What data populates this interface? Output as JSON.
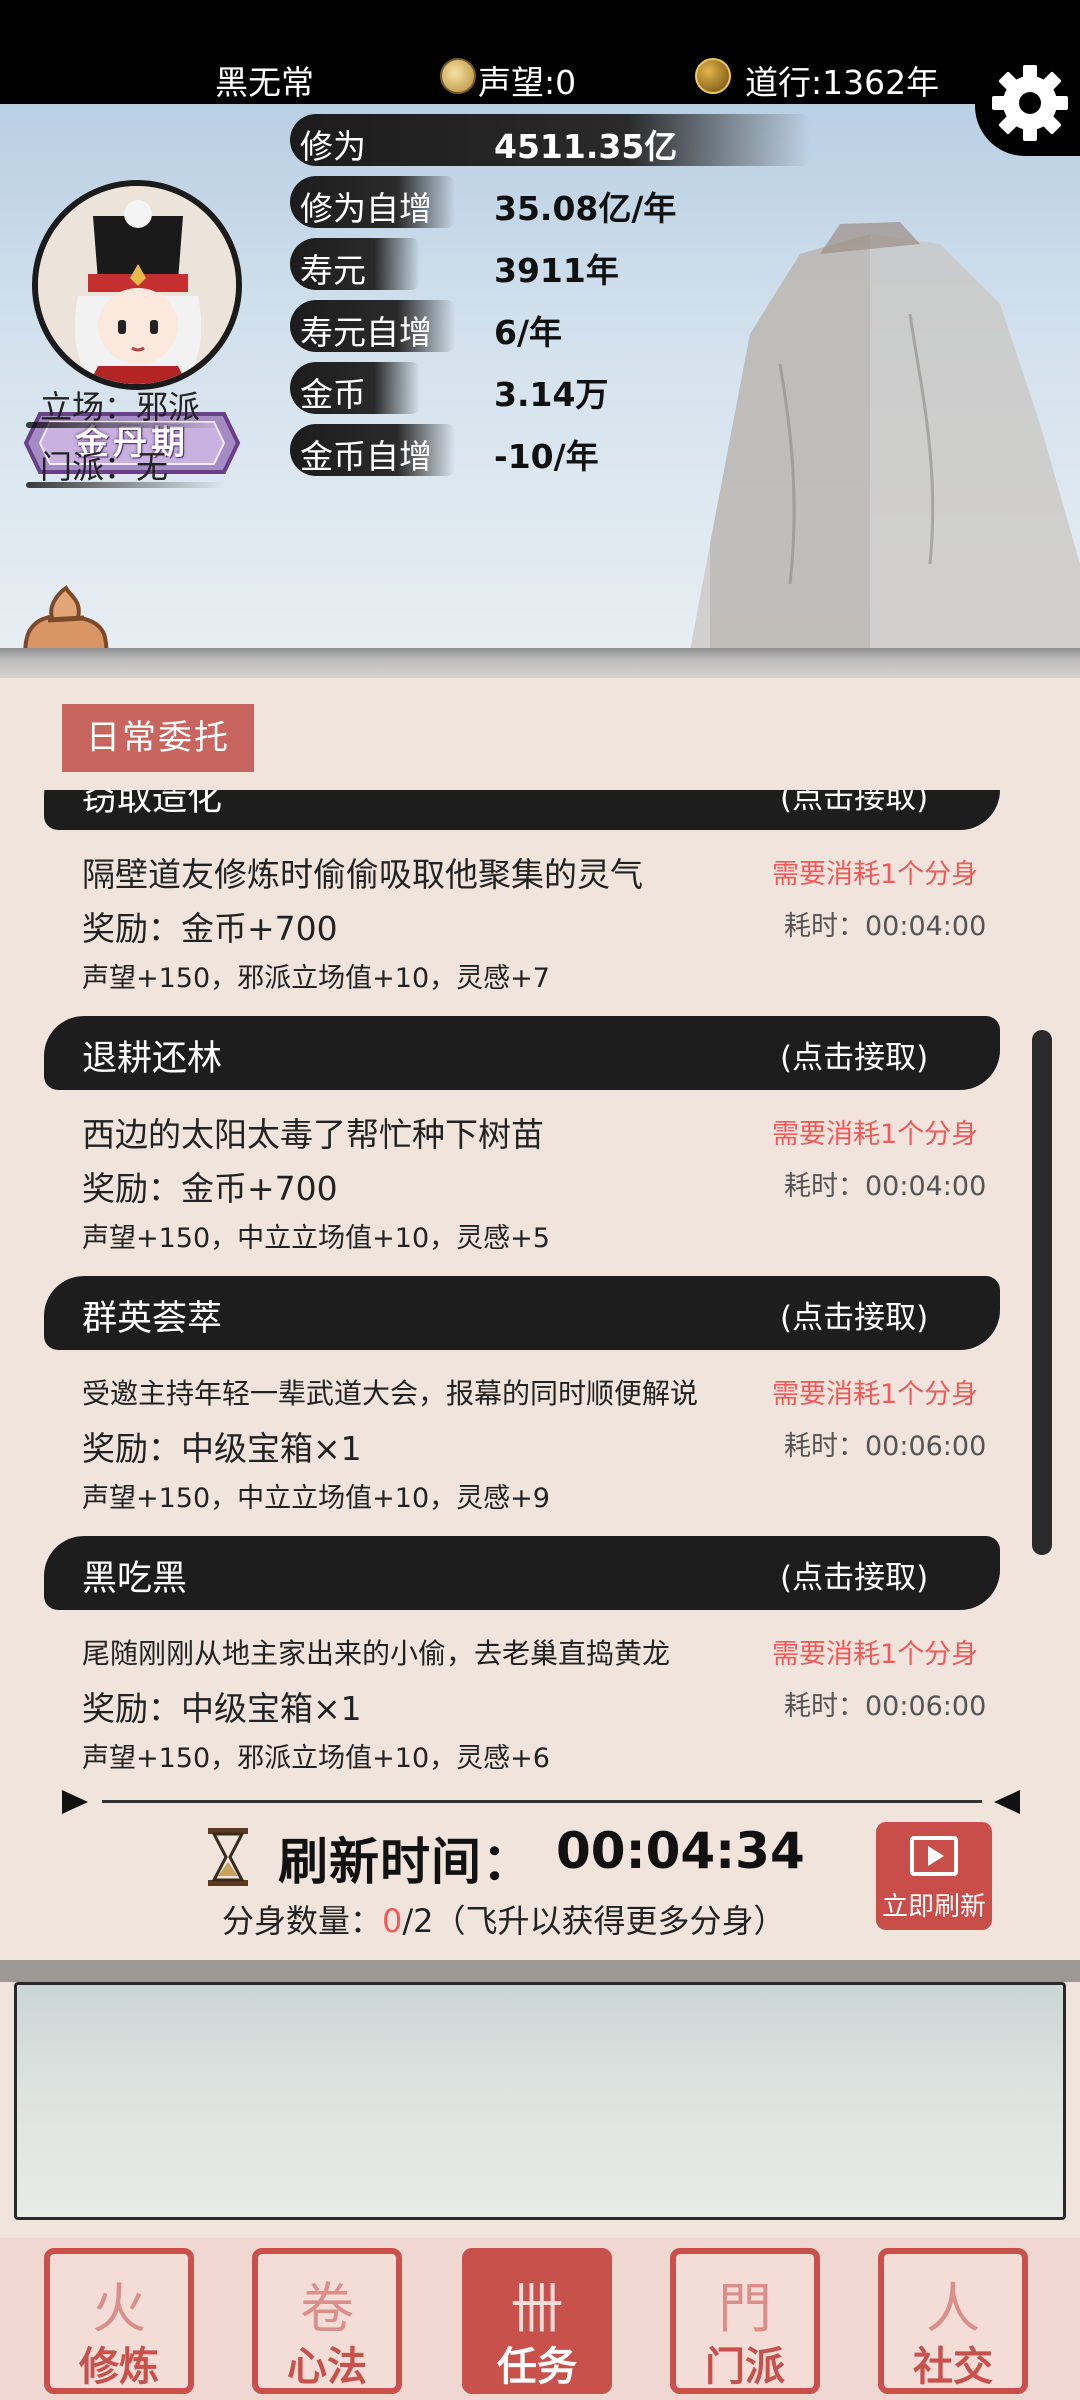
{
  "topbar": {
    "player_name": "黑无常",
    "reputation": "声望:0",
    "dao": "道行:1362年"
  },
  "profile": {
    "rank": "金丹期",
    "stance": "立场：邪派",
    "sect": "门派：无"
  },
  "stats": [
    {
      "key": "修为",
      "value": "4511.35亿"
    },
    {
      "key": "修为自增",
      "value": "35.08亿/年"
    },
    {
      "key": "寿元",
      "value": "3911年"
    },
    {
      "key": "寿元自增",
      "value": "6/年"
    },
    {
      "key": "金币",
      "value": "3.14万"
    },
    {
      "key": "金币自增",
      "value": "-10/年"
    }
  ],
  "daily": {
    "tag": "日常委托",
    "accept_label": "(点击接取)",
    "tasks": [
      {
        "title": "窃取造化",
        "desc": "隔壁道友修炼时偷偷吸取他聚集的灵气",
        "cost": "需要消耗1个分身",
        "reward": "奖励：金币+700",
        "time": "耗时：00:04:00",
        "extra": "声望+150，邪派立场值+10，灵感+7"
      },
      {
        "title": "退耕还林",
        "desc": "西边的太阳太毒了帮忙种下树苗",
        "cost": "需要消耗1个分身",
        "reward": "奖励：金币+700",
        "time": "耗时：00:04:00",
        "extra": "声望+150，中立立场值+10，灵感+5"
      },
      {
        "title": "群英荟萃",
        "desc": "受邀主持年轻一辈武道大会，报幕的同时顺便解说",
        "cost": "需要消耗1个分身",
        "reward": "奖励：中级宝箱×1",
        "time": "耗时：00:06:00",
        "extra": "声望+150，中立立场值+10，灵感+9"
      },
      {
        "title": "黑吃黑",
        "desc": "尾随刚刚从地主家出来的小偷，去老巢直捣黄龙",
        "cost": "需要消耗1个分身",
        "reward": "奖励：中级宝箱×1",
        "time": "耗时：00:06:00",
        "extra": "声望+150，邪派立场值+10，灵感+6"
      }
    ]
  },
  "refresh": {
    "label": "刷新时间：",
    "time": "00:04:34",
    "clones_prefix": "分身数量：",
    "clones_used": "0",
    "clones_suffix": "/2（飞升以获得更多分身）",
    "button": "立即刷新"
  },
  "nav": [
    {
      "label": "修炼",
      "glyph": "⽕"
    },
    {
      "label": "心法",
      "glyph": "卷"
    },
    {
      "label": "任务",
      "glyph": "卌"
    },
    {
      "label": "门派",
      "glyph": "⾨"
    },
    {
      "label": "社交",
      "glyph": "⼈"
    }
  ],
  "colors": {
    "accent_red": "#c8514c",
    "cost_red": "#f25a5a",
    "ink": "#1d1d1d"
  }
}
